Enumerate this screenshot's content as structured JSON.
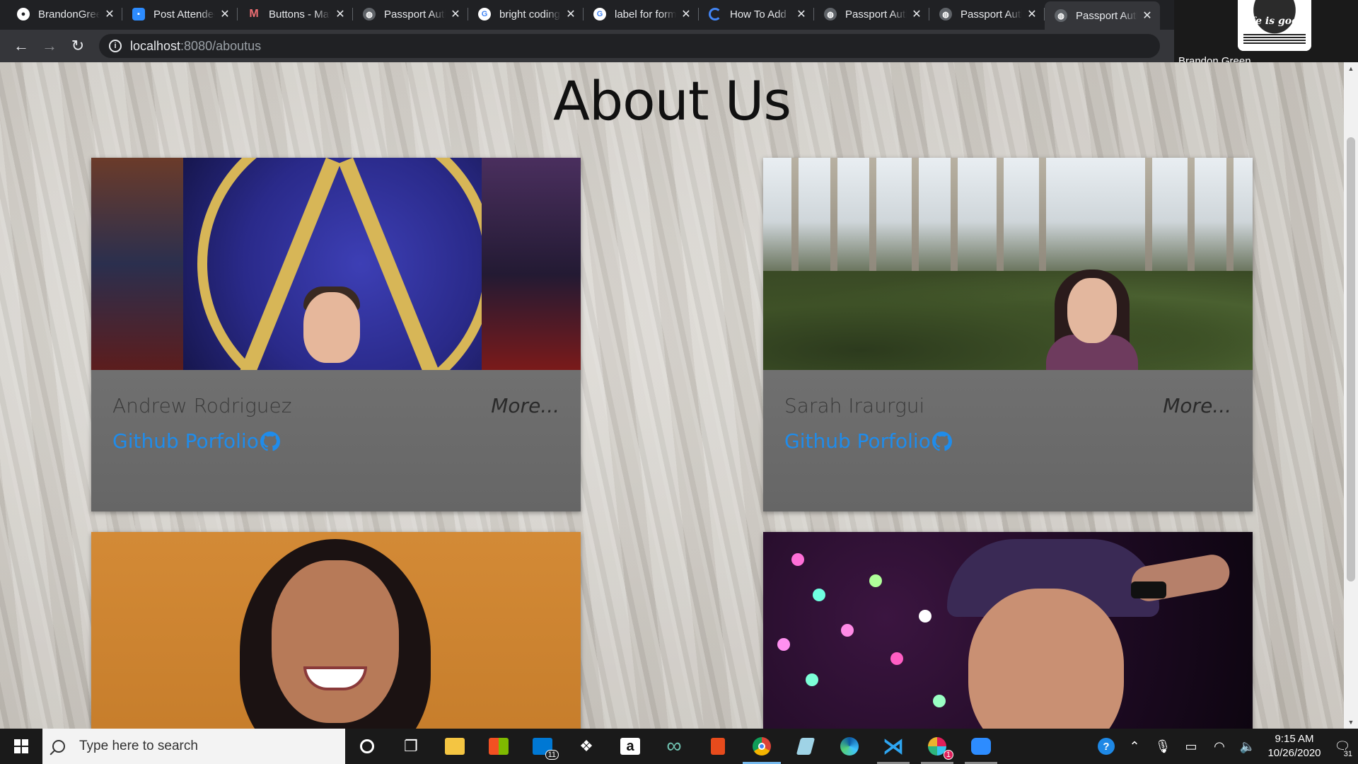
{
  "browser": {
    "tabs": [
      {
        "title": "BrandonGreen",
        "favicon": "github-icon",
        "color": "#ffffff"
      },
      {
        "title": "Post Attendee",
        "favicon": "zoom-icon",
        "color": "#2d8cff"
      },
      {
        "title": "Buttons - Materialize",
        "favicon": "materialize-icon",
        "color": "#ee6e73"
      },
      {
        "title": "Passport Authentication",
        "favicon": "globe-icon",
        "color": "#9aa0a6"
      },
      {
        "title": "bright coding",
        "favicon": "google-icon",
        "color": "#ffffff"
      },
      {
        "title": "label for form",
        "favicon": "google-icon",
        "color": "#ffffff"
      },
      {
        "title": "How To Add",
        "favicon": "spinner-icon",
        "color": "#4285f4"
      },
      {
        "title": "Passport Authentication",
        "favicon": "globe-icon",
        "color": "#9aa0a6"
      },
      {
        "title": "Passport Authentication",
        "favicon": "globe-icon",
        "color": "#9aa0a6"
      },
      {
        "title": "Passport Authentication",
        "favicon": "globe-icon",
        "color": "#9aa0a6"
      }
    ],
    "active_tab_index": 9,
    "url_host": "localhost",
    "url_path": ":8080/aboutus"
  },
  "video_overlay": {
    "participant_name": "Brandon Green",
    "shirt_text": "Life is good."
  },
  "page": {
    "title": "About Us",
    "cards": [
      {
        "name": "Andrew Rodriguez",
        "more_label": "More...",
        "github_label": "Github Porfolio"
      },
      {
        "name": "Sarah Iraurgui",
        "more_label": "More...",
        "github_label": "Github Porfolio"
      },
      {
        "name": "",
        "more_label": "",
        "github_label": ""
      },
      {
        "name": "",
        "more_label": "",
        "github_label": ""
      }
    ]
  },
  "taskbar": {
    "search_placeholder": "Type here to search",
    "apps": [
      {
        "name": "cortana-icon",
        "state": "none"
      },
      {
        "name": "task-view-icon",
        "state": "none"
      },
      {
        "name": "file-explorer-icon",
        "state": "none"
      },
      {
        "name": "microsoft-store-icon",
        "state": "none"
      },
      {
        "name": "mail-icon",
        "state": "none",
        "badge": "11"
      },
      {
        "name": "dropbox-icon",
        "state": "none"
      },
      {
        "name": "amazon-icon",
        "state": "none"
      },
      {
        "name": "infinity-icon",
        "state": "none"
      },
      {
        "name": "office-icon",
        "state": "none"
      },
      {
        "name": "chrome-icon",
        "state": "active"
      },
      {
        "name": "notepad-icon",
        "state": "none"
      },
      {
        "name": "edge-icon",
        "state": "none"
      },
      {
        "name": "vscode-icon",
        "state": "running"
      },
      {
        "name": "slack-icon",
        "state": "running",
        "badge": "1"
      },
      {
        "name": "zoom-icon",
        "state": "running"
      }
    ],
    "time": "9:15 AM",
    "date": "10/26/2020",
    "notification_count": "31"
  }
}
